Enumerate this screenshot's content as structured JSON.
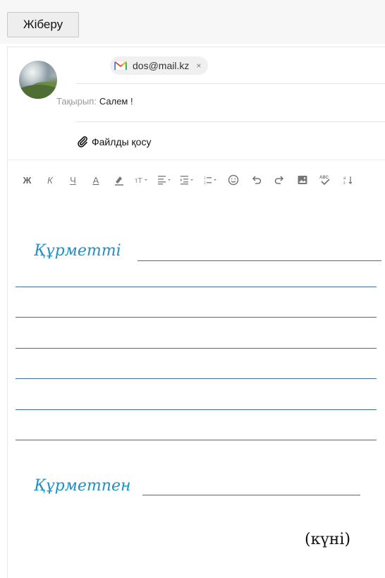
{
  "toolbar": {
    "send_label": "Жіберу"
  },
  "recipient": {
    "email": "dos@mail.kz",
    "remove": "×"
  },
  "subject": {
    "label": "Тақырып:",
    "value": "Салем !"
  },
  "attach": {
    "label": "Файлды қосу"
  },
  "format_toolbar": {
    "bold": "Ж",
    "italic": "К",
    "underline": "Ч",
    "text_color": "A"
  },
  "letter": {
    "greeting": "Құрметті",
    "closing": "Құрметпен",
    "date": "(күні)"
  },
  "colors": {
    "accent_text": "#1e90c8",
    "rule_line": "#3d6f9a"
  }
}
